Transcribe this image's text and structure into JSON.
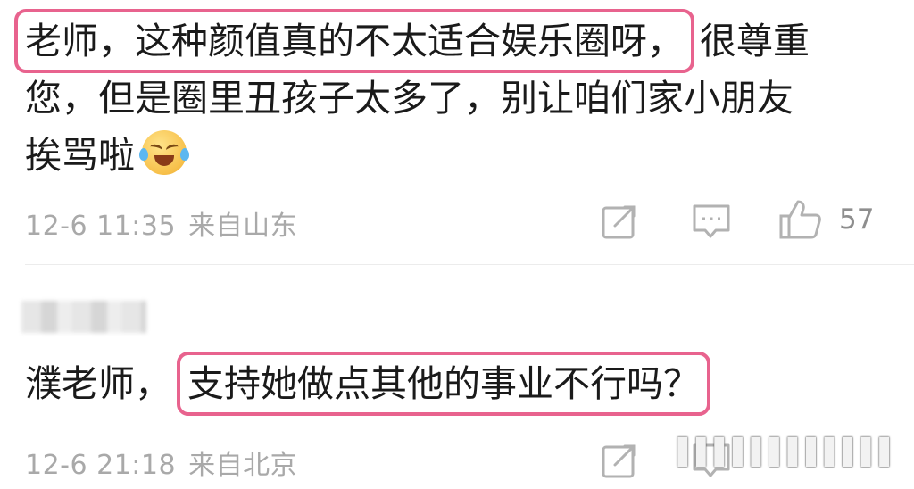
{
  "comment1": {
    "highlight_text": "老师，这种颜值真的不太适合娱乐圈呀，",
    "line1_rest": "很尊重",
    "line2": "您，但是圈里丑孩子太多了，别让咱们家小朋友",
    "line3": "挨骂啦",
    "emoji": "laughing-crying-emoji",
    "time": "12-6 11:35",
    "location": "来自山东",
    "like_count": "57"
  },
  "comment2": {
    "prefix": "濮老师，",
    "highlight_text": "支持她做点其他的事业不行吗？",
    "time": "12-6 21:18",
    "location": "来自北京"
  },
  "colors": {
    "highlight_border": "#e8638e",
    "meta_text": "#a9a9a9",
    "icon": "#b2b2b2"
  }
}
